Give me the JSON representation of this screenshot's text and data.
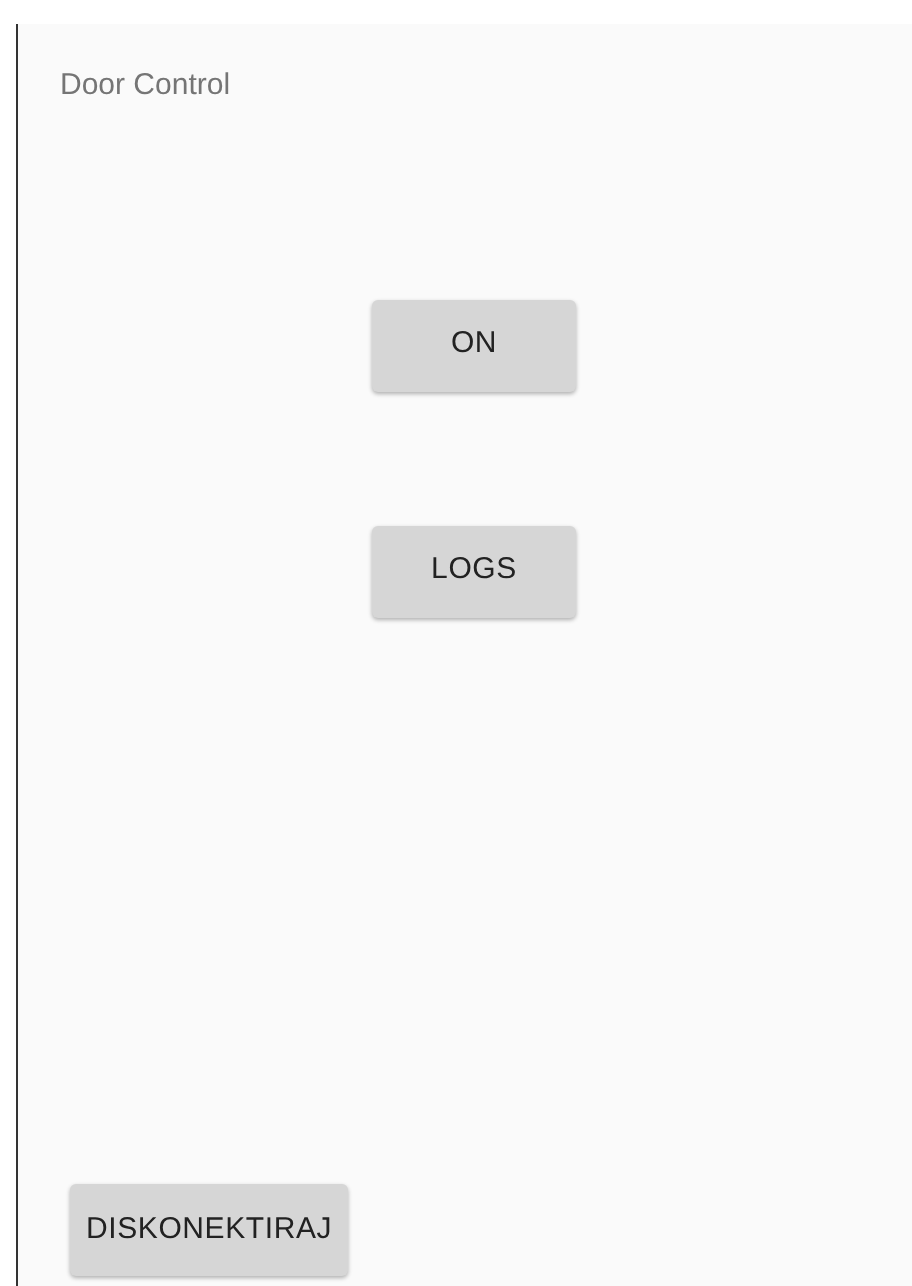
{
  "title": "Door Control",
  "buttons": [
    {
      "label": "ON"
    },
    {
      "label": "LOGS"
    }
  ],
  "footer_button": {
    "label": "DISKONEKTIRAJ"
  }
}
